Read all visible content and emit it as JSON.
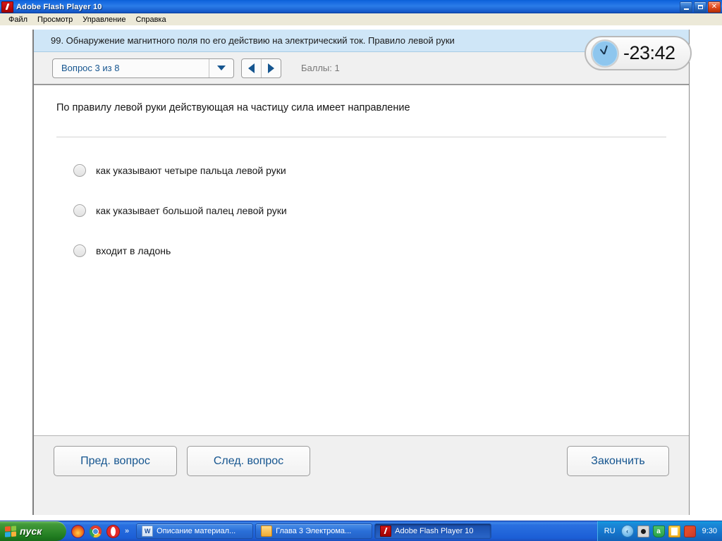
{
  "window": {
    "title": "Adobe Flash Player 10",
    "icon": "flash-icon",
    "buttons": {
      "minimize": "minimize",
      "maximize": "maximize",
      "close": "✕"
    }
  },
  "menubar": {
    "items": [
      {
        "label": "Файл"
      },
      {
        "label": "Просмотр"
      },
      {
        "label": "Управление"
      },
      {
        "label": "Справка"
      }
    ]
  },
  "quiz": {
    "header_title": "99. Обнаружение магнитного поля по его действию на электрический ток. Правило левой руки",
    "question_selector": "Вопрос 3 из 8",
    "score_label": "Баллы: 1",
    "timer": "-23:42",
    "question_text": "По правилу левой руки действующая на частицу сила имеет направление",
    "answers": [
      {
        "label": "как указывают четыре пальца левой руки",
        "selected": false
      },
      {
        "label": "как указывает большой палец левой руки",
        "selected": false
      },
      {
        "label": "входит в ладонь",
        "selected": false
      }
    ],
    "footer": {
      "prev": "Пред. вопрос",
      "next": "След. вопрос",
      "finish": "Закончить"
    }
  },
  "taskbar": {
    "start_label": "пуск",
    "quicklaunch_overflow": "»",
    "tasks": [
      {
        "label": "Описание материал...",
        "icon": "word-document-icon",
        "active": false
      },
      {
        "label": "Глава 3  Электрома...",
        "icon": "folder-icon",
        "active": false
      },
      {
        "label": "Adobe Flash Player 10",
        "icon": "flash-icon",
        "active": true
      }
    ],
    "tray": {
      "language": "RU",
      "chevron": "‹",
      "clock": "9:30"
    }
  },
  "colors": {
    "titlebar_blue": "#1266de",
    "header_band": "#cfe6f7",
    "accent_link": "#15558f",
    "toolbar_gray": "#f0f0f0"
  }
}
